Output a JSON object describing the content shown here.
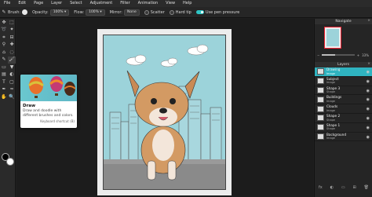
{
  "menubar": {
    "items": [
      "File",
      "Edit",
      "Page",
      "Layer",
      "Select",
      "Adjustment",
      "Filter",
      "Animation",
      "View",
      "Help"
    ]
  },
  "options": {
    "brush_label": "Brush:",
    "opacity_label": "Opacity:",
    "opacity_value": "100% ▾",
    "flow_label": "Flow:",
    "flow_value": "100% ▾",
    "mirror_label": "Mirror:",
    "mirror_value": "None",
    "scatter_label": "Scatter",
    "hard_tip_label": "Hard tip",
    "pen_pressure_label": "Use pen pressure",
    "accent_color": "#2fc5c5"
  },
  "tools": {
    "items": [
      "move-icon",
      "select-icon",
      "lasso-icon",
      "wand-icon",
      "crop-icon",
      "slice-icon",
      "eyedropper-icon",
      "spot-heal-icon",
      "stamp-icon",
      "blur-icon",
      "pencil-icon",
      "brush-icon",
      "eraser-icon",
      "fill-icon",
      "gradient-icon",
      "dodge-icon",
      "type-icon",
      "shape-icon",
      "pen-icon",
      "liquify-icon",
      "hand-icon",
      "zoom-icon"
    ],
    "glyphs": [
      "✥",
      "⬚",
      "➰",
      "✦",
      "⌗",
      "⊟",
      "⚲",
      "✚",
      "⌂",
      "◌",
      "✎",
      "🖌",
      "▭",
      "▼",
      "▤",
      "◐",
      "T",
      "▢",
      "✒",
      "≈",
      "✋",
      "🔍"
    ],
    "active_index": 11,
    "fg_color": "#000000",
    "bg_color": "#ffffff"
  },
  "tooltip": {
    "title": "Draw",
    "description": "Draw and doodle with different brushes and colors.",
    "shortcut": "Keyboard shortcut (B)"
  },
  "navigator": {
    "title": "Navigate",
    "close": "×",
    "zoom_out": "−",
    "zoom_in": "+",
    "zoom_level": "33%",
    "zoom_fraction": 0.4
  },
  "layers_panel": {
    "title": "Layers",
    "close": "×",
    "layers": [
      {
        "name": "Drawing",
        "type": "Image",
        "active": true
      },
      {
        "name": "Subject",
        "type": "Image",
        "active": false
      },
      {
        "name": "Shape 3",
        "type": "Shape",
        "active": false
      },
      {
        "name": "Buildings",
        "type": "Image",
        "active": false
      },
      {
        "name": "Clouds",
        "type": "Image",
        "active": false
      },
      {
        "name": "Shape 2",
        "type": "Shape",
        "active": false
      },
      {
        "name": "Shape 1",
        "type": "Shape",
        "active": false
      },
      {
        "name": "Background",
        "type": "Image",
        "active": false
      }
    ],
    "active_color": "#2fb3c0"
  }
}
